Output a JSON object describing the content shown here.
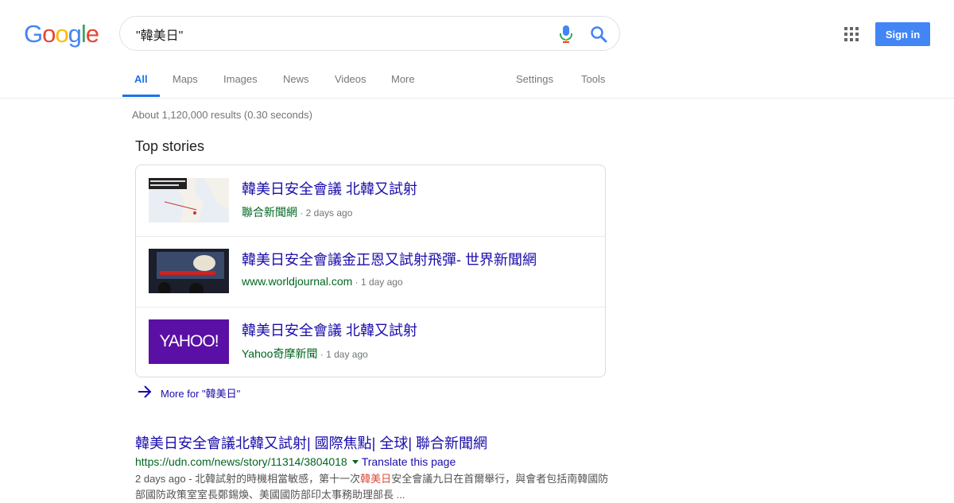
{
  "logo": {
    "letters": [
      "G",
      "o",
      "o",
      "g",
      "l",
      "e"
    ],
    "colors": [
      "#4285F4",
      "#EA4335",
      "#FBBC05",
      "#4285F4",
      "#34A853",
      "#EA4335"
    ]
  },
  "search": {
    "query": "\"韓美日\""
  },
  "header": {
    "signin_label": "Sign in"
  },
  "tabs": {
    "all": "All",
    "maps": "Maps",
    "images": "Images",
    "news": "News",
    "videos": "Videos",
    "more": "More",
    "settings": "Settings",
    "tools": "Tools"
  },
  "stats": "About 1,120,000 results (0.30 seconds)",
  "top_stories": {
    "title": "Top stories",
    "items": [
      {
        "title": "韓美日安全會議 北韓又試射",
        "source": "聯合新聞網",
        "time": " · 2 days ago"
      },
      {
        "title": "韓美日安全會議金正恩又試射飛彈- 世界新聞網",
        "source": "www.worldjournal.com",
        "time": " · 1 day ago"
      },
      {
        "title": "韓美日安全會議 北韓又試射",
        "source": "Yahoo奇摩新聞",
        "time": " · 1 day ago",
        "thumb_text": "YAHOO!"
      }
    ],
    "more_label": "More for \"韓美日\""
  },
  "result": {
    "title": "韓美日安全會議北韓又試射| 國際焦點| 全球| 聯合新聞網",
    "url": "https://udn.com/news/story/11314/3804018",
    "translate": "Translate this page",
    "snippet_pre": "2 days ago - 北韓試射的時機相當敏感，第十一次",
    "snippet_em": "韓美日",
    "snippet_post": "安全會議九日在首爾舉行，與會者包括南韓國防部國防政策室室長鄭錫煥、美國國防部印太事務助理部長 ..."
  },
  "colors": {
    "link": "#1a0dab",
    "url": "#006621",
    "accent": "#1a73e8",
    "signin": "#4285f4"
  }
}
